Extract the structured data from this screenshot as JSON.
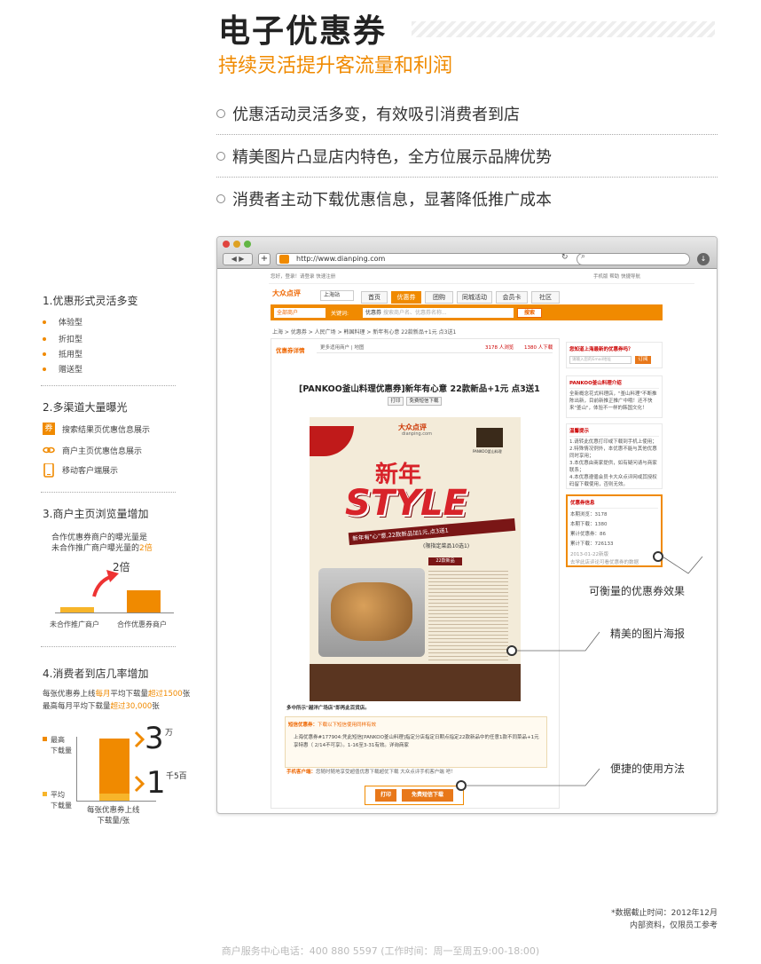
{
  "header": {
    "title": "电子优惠券",
    "subtitle": "持续灵活提升客流量和利润"
  },
  "features": [
    "优惠活动灵活多变，有效吸引消费者到店",
    "精美图片凸显店内特色，全方位展示品牌优势",
    "消费者主动下载优惠信息，显著降低推广成本"
  ],
  "left": {
    "s1": {
      "title": "1.优惠形式灵活多变",
      "items": [
        "体验型",
        "折扣型",
        "抵用型",
        "赠送型"
      ]
    },
    "s2": {
      "title": "2.多渠道大量曝光",
      "items": [
        "搜索结果页优惠信息展示",
        "商户主页优惠信息展示",
        "移动客户端展示"
      ],
      "coupon_glyph": "券"
    },
    "s3": {
      "title": "3.商户主页浏览量增加",
      "desc1": "合作优惠券商户的曝光量是",
      "desc2a": "未合作推广商户曝光量的",
      "desc2b": "2倍",
      "multiple": "2倍",
      "bar1": "未合作推广商户",
      "bar2": "合作优惠券商户"
    },
    "s4": {
      "title": "4.消费者到店几率增加",
      "l1a": "每张优惠券上线",
      "l1b": "每月",
      "l1c": "平均下载量",
      "l1d": "超过1500",
      "l1e": "张",
      "l2a": "最高每月平均下载量",
      "l2b": "超过30,000",
      "l2c": "张",
      "max_label1": "最高",
      "max_label2": "下载量",
      "avg_label1": "平均",
      "avg_label2": "下载量",
      "big_num": "3",
      "big_unit": "万",
      "small_num": "1",
      "small_unit": "千5百",
      "x_label1": "每张优惠券上线",
      "x_label2": "下载量/张"
    }
  },
  "browser": {
    "url": "http://www.dianping.com",
    "top_links": "您好，登录！请登录  快速注册",
    "top_right": "手机版  帮助  快捷导航",
    "logo": "大众点评",
    "city": "上海站",
    "tabs": [
      "首页",
      "优惠券",
      "团购",
      "同城活动",
      "会员卡",
      "社区"
    ],
    "category": "全部商户",
    "kw_label": "关键词:",
    "kw_value": "优惠券",
    "kw_placeholder": "搜索商户名、优惠券名称...",
    "search_btn": "搜索",
    "crumb": "上海 > 优惠券 > 人民广场 > 韩国料理 > 新年有心意 22款新品+1元 点3送1",
    "detail_tab": "优惠券详情",
    "detail_links": "更多适用商户  |  地图",
    "views": "3178 人浏览",
    "downloads": "1380 人下载",
    "coupon_title": "[PANKOO釜山料理优惠券]新年有心意 22款新品+1元 点3送1",
    "btn_print_small": "打印",
    "btn_dl_small": "免费短信下载",
    "poster": {
      "brand": "大众点评",
      "brand_url": "dianping.com",
      "pankoo": "PANKOO釜山料理",
      "xinnian": "新年",
      "style": "STYLE",
      "tagline": "新年有\"心\"意,22款新品加1元,点3送1",
      "limit": "(限指定菜品10选1)",
      "menu_title": "22款新品"
    },
    "store": "多中所示\"越洋广场店\"即再此百货店。",
    "notice_title": "短信优惠券：",
    "notice_text": "下载以下短信使用同样有效",
    "notice_body": "上海优惠券#177904:凭此短信[PANKOO釜山料理]指定分店指定日期点指定22款新品中的任意1款不同菜品+1元享特惠（ 2/14不可享）。1-16至3-31有效。详询商家",
    "mobile_label": "手机客户端：",
    "mobile_text": "您随时随地享受超值优惠下载超优下载 大众点评手机客户端 吧！",
    "btn_print": "打印",
    "btn_download": "免费短信下载",
    "side1_title": "您知道上海最新的优惠券吗？",
    "side1_input": "请输入您的Email地址",
    "side1_btn": "订阅",
    "side2_title": "PANKOO釜山料理介绍",
    "side2_body": "全新概念花式料理店，\"釜山料理\"不断推陈出新，目前新推正推广中哦！还不快来\"釜山\"，体验不一样的韩国文化！",
    "side3_title": "温馨提示",
    "side3_body": [
      "1.请转此优惠打印或下载到手机上使用；",
      "2.特殊情况例外，本优惠不能与其他优惠同时享用；",
      "3.本优惠由商家提供，如有疑问请与商家联系；",
      "4.本优惠遵循会员卡大众点评网或其授权码留下载使用，否则无效。"
    ],
    "side4_title": "优惠券信息",
    "side4_rows": [
      "本期浏览：3178",
      "本期下载：1380",
      "累计优惠券：86",
      "累计下载：726133"
    ],
    "side4_date": "2013-01-22新版",
    "side4_note": "去学此店评论可看优惠券的数据"
  },
  "callouts": [
    "可衡量的优惠券效果",
    "精美的图片海报",
    "便捷的使用方法"
  ],
  "footnote": {
    "line1": "*数据截止时间：2012年12月",
    "line2": "内部资料，仅限员工参考"
  },
  "footer": "商户服务中心电话：400 880 5597 (工作时间：周一至周五9:00-18:00)",
  "colors": {
    "accent": "#f08a00",
    "light": "#f7b52a"
  }
}
